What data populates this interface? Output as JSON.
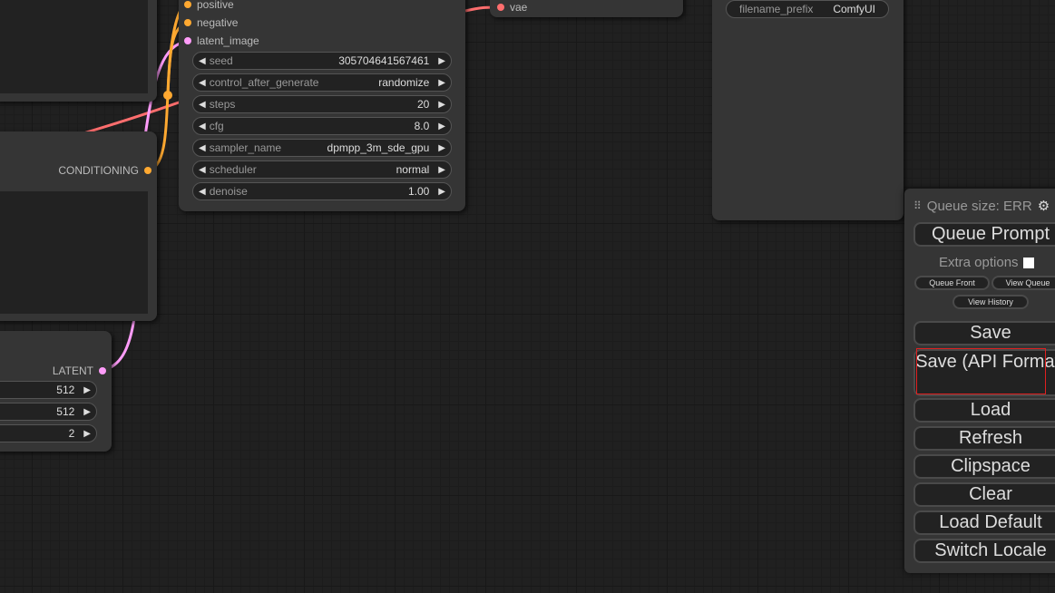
{
  "ksampler": {
    "inputs": [
      "positive",
      "negative",
      "latent_image"
    ],
    "widgets": [
      {
        "label": "seed",
        "value": "305704641567461"
      },
      {
        "label": "control_after_generate",
        "value": "randomize"
      },
      {
        "label": "steps",
        "value": "20"
      },
      {
        "label": "cfg",
        "value": "8.0"
      },
      {
        "label": "sampler_name",
        "value": "dpmpp_3m_sde_gpu"
      },
      {
        "label": "scheduler",
        "value": "normal"
      },
      {
        "label": "denoise",
        "value": "1.00"
      }
    ]
  },
  "clip_node": {
    "output": "CONDITIONING"
  },
  "latent_node": {
    "output": "LATENT",
    "widgets": [
      "512",
      "512",
      "2"
    ]
  },
  "vae_node": {
    "input": "vae"
  },
  "save_node": {
    "widget_label": "filename_prefix",
    "widget_value": "ComfyUI"
  },
  "queue_panel": {
    "title": "Queue size: ERR",
    "queue_prompt": "Queue Prompt",
    "extra_options": "Extra options",
    "queue_front": "Queue Front",
    "view_queue": "View Queue",
    "view_history": "View History",
    "buttons": [
      "Save",
      "Save (API Format)",
      "Load",
      "Refresh",
      "Clipspace",
      "Clear",
      "Load Default",
      "Switch Locale"
    ]
  },
  "colors": {
    "conditioning": "#ffa931",
    "latent": "#ff9cf9",
    "vae": "#ff6e6e",
    "highlight": "#e02020"
  }
}
